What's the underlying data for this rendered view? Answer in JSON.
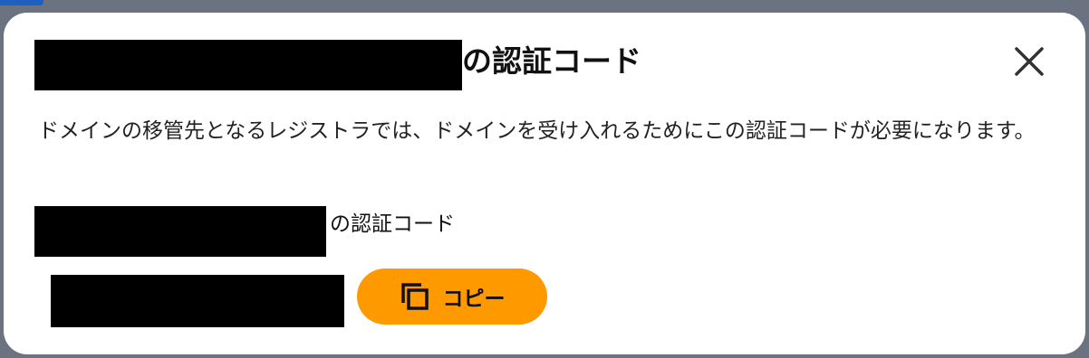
{
  "dialog": {
    "title_suffix": "の認証コード",
    "close_icon": "close-icon",
    "description": "ドメインの移管先となるレジストラでは、ドメインを受け入れるためにこの認証コードが必要になります。",
    "code_label_suffix": "の認証コード",
    "copy_button": {
      "label": "コピー",
      "icon": "copy-icon",
      "color": "#ff9900"
    }
  }
}
